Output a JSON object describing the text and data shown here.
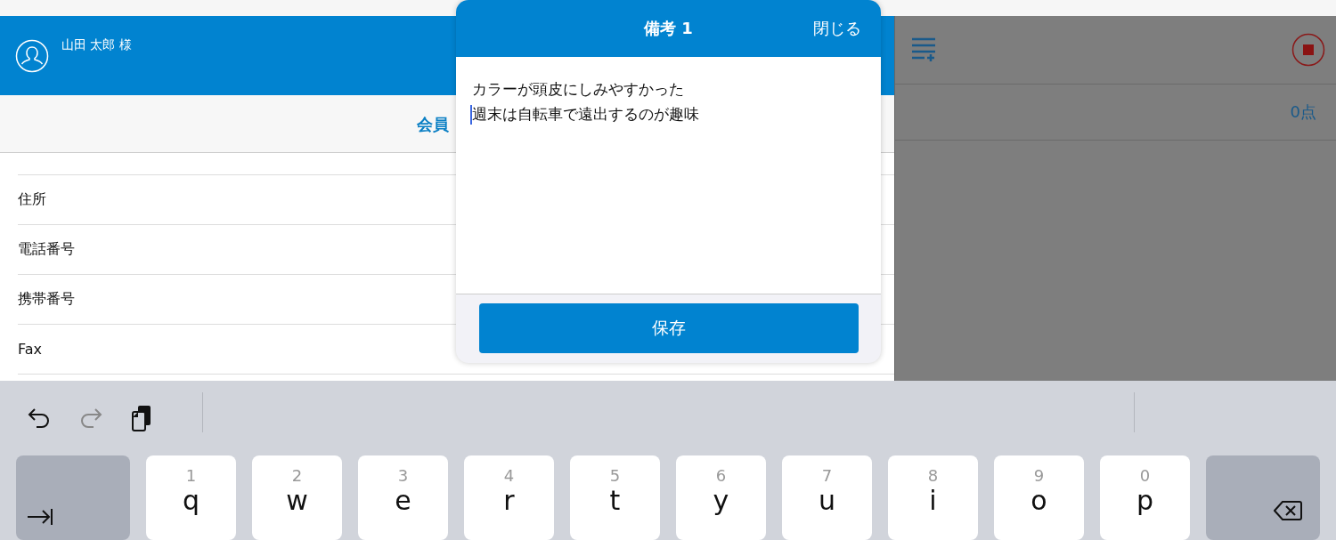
{
  "member_panel": {
    "customer_name": "山田 太郎 様",
    "section_title": "会員",
    "rows": [
      {
        "label": "住所"
      },
      {
        "label": "電話番号"
      },
      {
        "label": "携帯番号"
      },
      {
        "label": "Fax"
      }
    ]
  },
  "side_panel": {
    "points": "0点"
  },
  "note_dialog": {
    "title": "備考 1",
    "close_button": "閉じる",
    "note_lines": [
      "カラーが頭皮にしみやすかった",
      "週末は自転車で遠出するのが趣味"
    ],
    "save_button": "保存"
  },
  "keyboard": {
    "keys": [
      {
        "kind": "tab"
      },
      {
        "kind": "letter",
        "hint": "1",
        "label": "q"
      },
      {
        "kind": "letter",
        "hint": "2",
        "label": "w"
      },
      {
        "kind": "letter",
        "hint": "3",
        "label": "e"
      },
      {
        "kind": "letter",
        "hint": "4",
        "label": "r"
      },
      {
        "kind": "letter",
        "hint": "5",
        "label": "t"
      },
      {
        "kind": "letter",
        "hint": "6",
        "label": "y"
      },
      {
        "kind": "letter",
        "hint": "7",
        "label": "u"
      },
      {
        "kind": "letter",
        "hint": "8",
        "label": "i"
      },
      {
        "kind": "letter",
        "hint": "9",
        "label": "o"
      },
      {
        "kind": "letter",
        "hint": "0",
        "label": "p"
      },
      {
        "kind": "backspace"
      }
    ]
  }
}
